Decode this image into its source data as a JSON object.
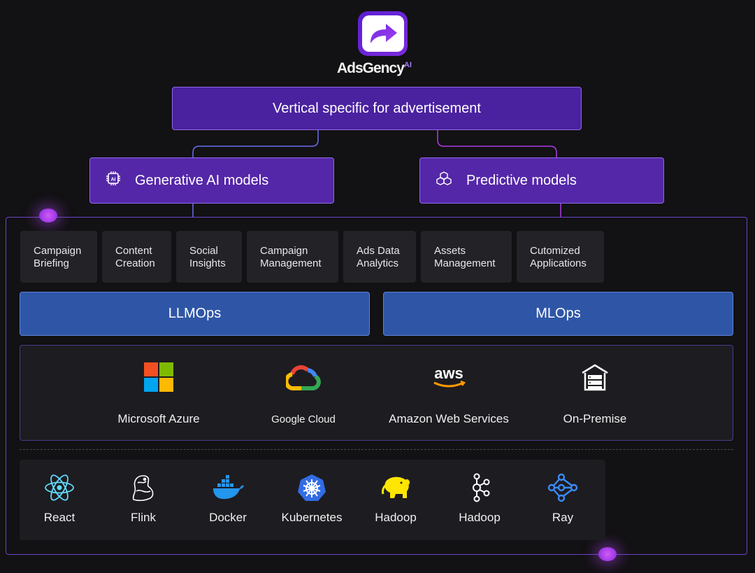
{
  "brand": {
    "name": "AdsGency",
    "suffix": "AI"
  },
  "vertical": {
    "label": "Vertical specific for advertisement"
  },
  "models": {
    "generative": {
      "label": "Generative AI models",
      "icon": "ai-chip-icon"
    },
    "predictive": {
      "label": "Predictive models",
      "icon": "cubes-icon"
    }
  },
  "applications": [
    {
      "line1": "Campaign",
      "line2": "Briefing"
    },
    {
      "line1": "Content",
      "line2": "Creation"
    },
    {
      "line1": "Social",
      "line2": "Insights"
    },
    {
      "line1": "Campaign",
      "line2": "Management"
    },
    {
      "line1": "Ads Data",
      "line2": "Analytics"
    },
    {
      "line1": "Assets",
      "line2": "Management"
    },
    {
      "line1": "Cutomized",
      "line2": "Applications"
    }
  ],
  "ops": {
    "llmops": "LLMOps",
    "mlops": "MLOps"
  },
  "clouds": [
    {
      "label": "Microsoft Azure",
      "icon": "microsoft-logo-icon"
    },
    {
      "label": "Google Cloud",
      "icon": "google-cloud-logo-icon"
    },
    {
      "label": "Amazon Web Services",
      "icon": "aws-logo-icon",
      "mark": "aws"
    },
    {
      "label": "On-Premise",
      "icon": "server-house-icon"
    }
  ],
  "tools": [
    {
      "label": "React",
      "icon": "react-icon"
    },
    {
      "label": "Flink",
      "icon": "flink-icon"
    },
    {
      "label": "Docker",
      "icon": "docker-icon"
    },
    {
      "label": "Kubernetes",
      "icon": "kubernetes-icon"
    },
    {
      "label": "Hadoop",
      "icon": "hadoop-elephant-icon"
    },
    {
      "label": "Hadoop",
      "icon": "kafka-nodes-icon"
    },
    {
      "label": "Ray",
      "icon": "ray-icon"
    }
  ],
  "colors": {
    "background": "#121113",
    "purple": "#5427a8",
    "blue": "#2f56a6",
    "card": "#232227"
  }
}
